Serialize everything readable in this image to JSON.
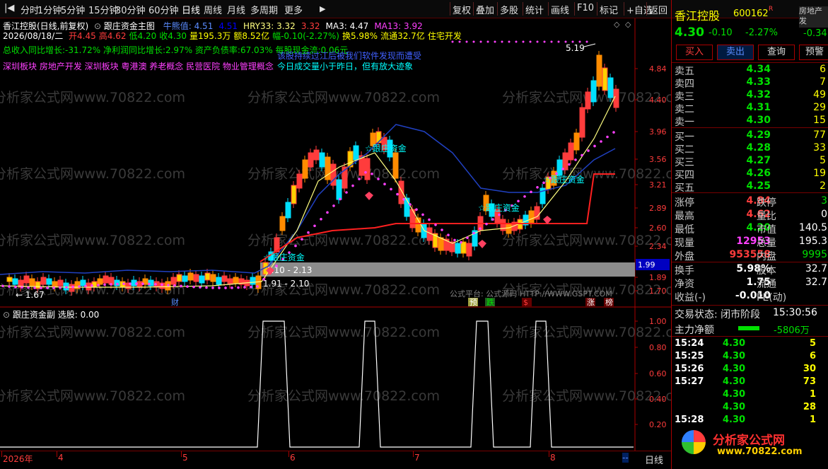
{
  "toolbar": {
    "left_items": [
      "分时",
      "1分钟",
      "5分钟",
      "15分钟",
      "30分钟",
      "60分钟",
      "日线",
      "周线",
      "月线",
      "多周期",
      "更多"
    ],
    "right_items": [
      "复权",
      "叠加",
      "多股",
      "统计",
      "画线",
      "F10",
      "标记",
      "+自选",
      "返回"
    ]
  },
  "main": {
    "title_line": "香江控股(日线,前复权)",
    "indicator_name": "跟庄资金主图",
    "legend": [
      {
        "text": "牛熊值: 4.51",
        "color": "#5a8cff"
      },
      {
        "text": "4.51",
        "color": "#0000ff"
      },
      {
        "text": "HRY33: 3.32",
        "color": "#ffff80"
      },
      {
        "text": "3.32",
        "color": "#ff3c3c"
      },
      {
        "text": "MA3: 4.47",
        "color": "#ffffff"
      },
      {
        "text": "MA13: 3.92",
        "color": "#ff40ff"
      }
    ],
    "quote_date": "2026/08/18/二",
    "quote": [
      {
        "text": "开4.45",
        "color": "#ff3c3c"
      },
      {
        "text": "高4.62",
        "color": "#ff3c3c"
      },
      {
        "text": "低4.20",
        "color": "#00e000"
      },
      {
        "text": "收4.30",
        "color": "#00e000"
      },
      {
        "text": "量195.3万",
        "color": "#ffff00"
      },
      {
        "text": "额8.52亿",
        "color": "#ffff00"
      },
      {
        "text": "幅-0.10(-2.27%)",
        "color": "#00e000"
      },
      {
        "text": "换5.98%",
        "color": "#ffff00"
      },
      {
        "text": "流通32.7亿",
        "color": "#ffff00"
      },
      {
        "text": "住宅开发",
        "color": "#ffff00"
      }
    ],
    "fundamentals": "总收入同比增长:-31.72% 净利润同比增长:2.97% 资产负债率:67.03% 每股现金流:0.06元",
    "concepts": "深圳板块 房地产开发 深圳板块 粤港澳 养老概念 民营医院 物业管理概念",
    "notice_blue": "该股持续过江后被我们软件发现而遭受",
    "notice_cyan": "今日成交量小于昨日，但有放大迹象",
    "price_labels": [
      "4.84",
      "4.40",
      "3.96",
      "3.56",
      "3.21",
      "2.89",
      "2.60",
      "2.34",
      "1.99",
      "1.89",
      "1.70"
    ],
    "annotations": {
      "high": "5.19",
      "low": "1.67",
      "band_label": "1.10 - 2.13",
      "band_label2": "1.91 - 2.10",
      "current_price_box": "1.99",
      "follow_fund_labels": [
        "跟庄资金",
        "跟庄资金",
        "跟庄资金",
        "跟庄资金"
      ],
      "platform_text": "公式平台: 公式源码 HTTP://WWW.GSPT.COM",
      "event_marks": [
        {
          "text": "财",
          "color": "#5a8cff"
        },
        {
          "text": "预",
          "color": "#ffffff"
        },
        {
          "text": "跌",
          "color": "#00e000"
        },
        {
          "text": "$",
          "color": "#ff3c3c"
        },
        {
          "text": "涨",
          "color": "#ffffff"
        },
        {
          "text": "榜",
          "color": "#ffffff"
        }
      ]
    },
    "watermark": "分析家公式网www.70822.com"
  },
  "sub": {
    "title": "跟庄资金副",
    "select_label": "选股: 0.00",
    "y_labels": [
      "1.00",
      "0.80",
      "0.60",
      "0.40",
      "0.20"
    ]
  },
  "bottom": {
    "years": [
      "2026年",
      "4",
      "5",
      "6",
      "7",
      "8"
    ],
    "period_label": "日线",
    "arrow_label": "--"
  },
  "side": {
    "stock_name": "香江控股",
    "code": "600162",
    "r_flag": "R",
    "sector_label": "房地产发",
    "sector_change": "-0.34",
    "price": "4.30",
    "change": "-0.10",
    "change_pct": "-2.27%",
    "buttons": [
      "买入",
      "卖出",
      "查询",
      "预警"
    ],
    "asks": [
      {
        "label": "卖五",
        "price": "4.34",
        "vol": "6"
      },
      {
        "label": "卖四",
        "price": "4.33",
        "vol": "7"
      },
      {
        "label": "卖三",
        "price": "4.32",
        "vol": "49"
      },
      {
        "label": "卖二",
        "price": "4.31",
        "vol": "29"
      },
      {
        "label": "卖一",
        "price": "4.30",
        "vol": "15"
      }
    ],
    "bids": [
      {
        "label": "买一",
        "price": "4.29",
        "vol": "77"
      },
      {
        "label": "买二",
        "price": "4.28",
        "vol": "33"
      },
      {
        "label": "买三",
        "price": "4.27",
        "vol": "5"
      },
      {
        "label": "买四",
        "price": "4.26",
        "vol": "19"
      },
      {
        "label": "买五",
        "price": "4.25",
        "vol": "2"
      }
    ],
    "stats": [
      {
        "l1": "涨停",
        "v1": "4.84",
        "c1": "#ff3c3c",
        "l2": "跌停",
        "v2": "3",
        "c2": "#00e000"
      },
      {
        "l1": "最高",
        "v1": "4.62",
        "c1": "#ff3c3c",
        "l2": "量比",
        "v2": "0",
        "c2": "#ffffff"
      },
      {
        "l1": "最低",
        "v1": "4.20",
        "c1": "#00e000",
        "l2": "市值",
        "v2": "140.5",
        "c2": "#ffffff"
      },
      {
        "l1": "现量",
        "v1": "12953",
        "c1": "#ff40ff",
        "l2": "总量",
        "v2": "195.3",
        "c2": "#ffffff"
      },
      {
        "l1": "外盘",
        "v1": "953558",
        "c1": "#ff3c3c",
        "l2": "内盘",
        "v2": "9995",
        "c2": "#00e000"
      }
    ],
    "stats2": [
      {
        "l1": "换手",
        "v1": "5.98%",
        "c1": "#ffffff",
        "l2": "股本",
        "v2": "32.7",
        "c2": "#ffffff"
      },
      {
        "l1": "净资",
        "v1": "1.75",
        "c1": "#ffffff",
        "l2": "流通",
        "v2": "32.7",
        "c2": "#ffffff"
      },
      {
        "l1": "收益(-)",
        "v1": "-0.010",
        "c1": "#ffffff",
        "l2": "PE(动)",
        "v2": "",
        "c2": "#ffffff"
      }
    ],
    "trade_status_label": "交易状态: 闭市阶段",
    "trade_time": "15:30:56",
    "main_net_label": "主力净额",
    "main_net_value": "-5806万",
    "ticks": [
      {
        "time": "15:24",
        "price": "4.30",
        "vol": "5"
      },
      {
        "time": "15:25",
        "price": "4.30",
        "vol": "6"
      },
      {
        "time": "15:26",
        "price": "4.30",
        "vol": "30"
      },
      {
        "time": "15:27",
        "price": "4.30",
        "vol": "73"
      },
      {
        "time": "",
        "price": "4.30",
        "vol": "1"
      },
      {
        "time": "",
        "price": "4.30",
        "vol": "28"
      },
      {
        "time": "15:28",
        "price": "4.30",
        "vol": "1"
      }
    ],
    "logo_text": "分析家公式网",
    "logo_url": "www.70822.com"
  }
}
